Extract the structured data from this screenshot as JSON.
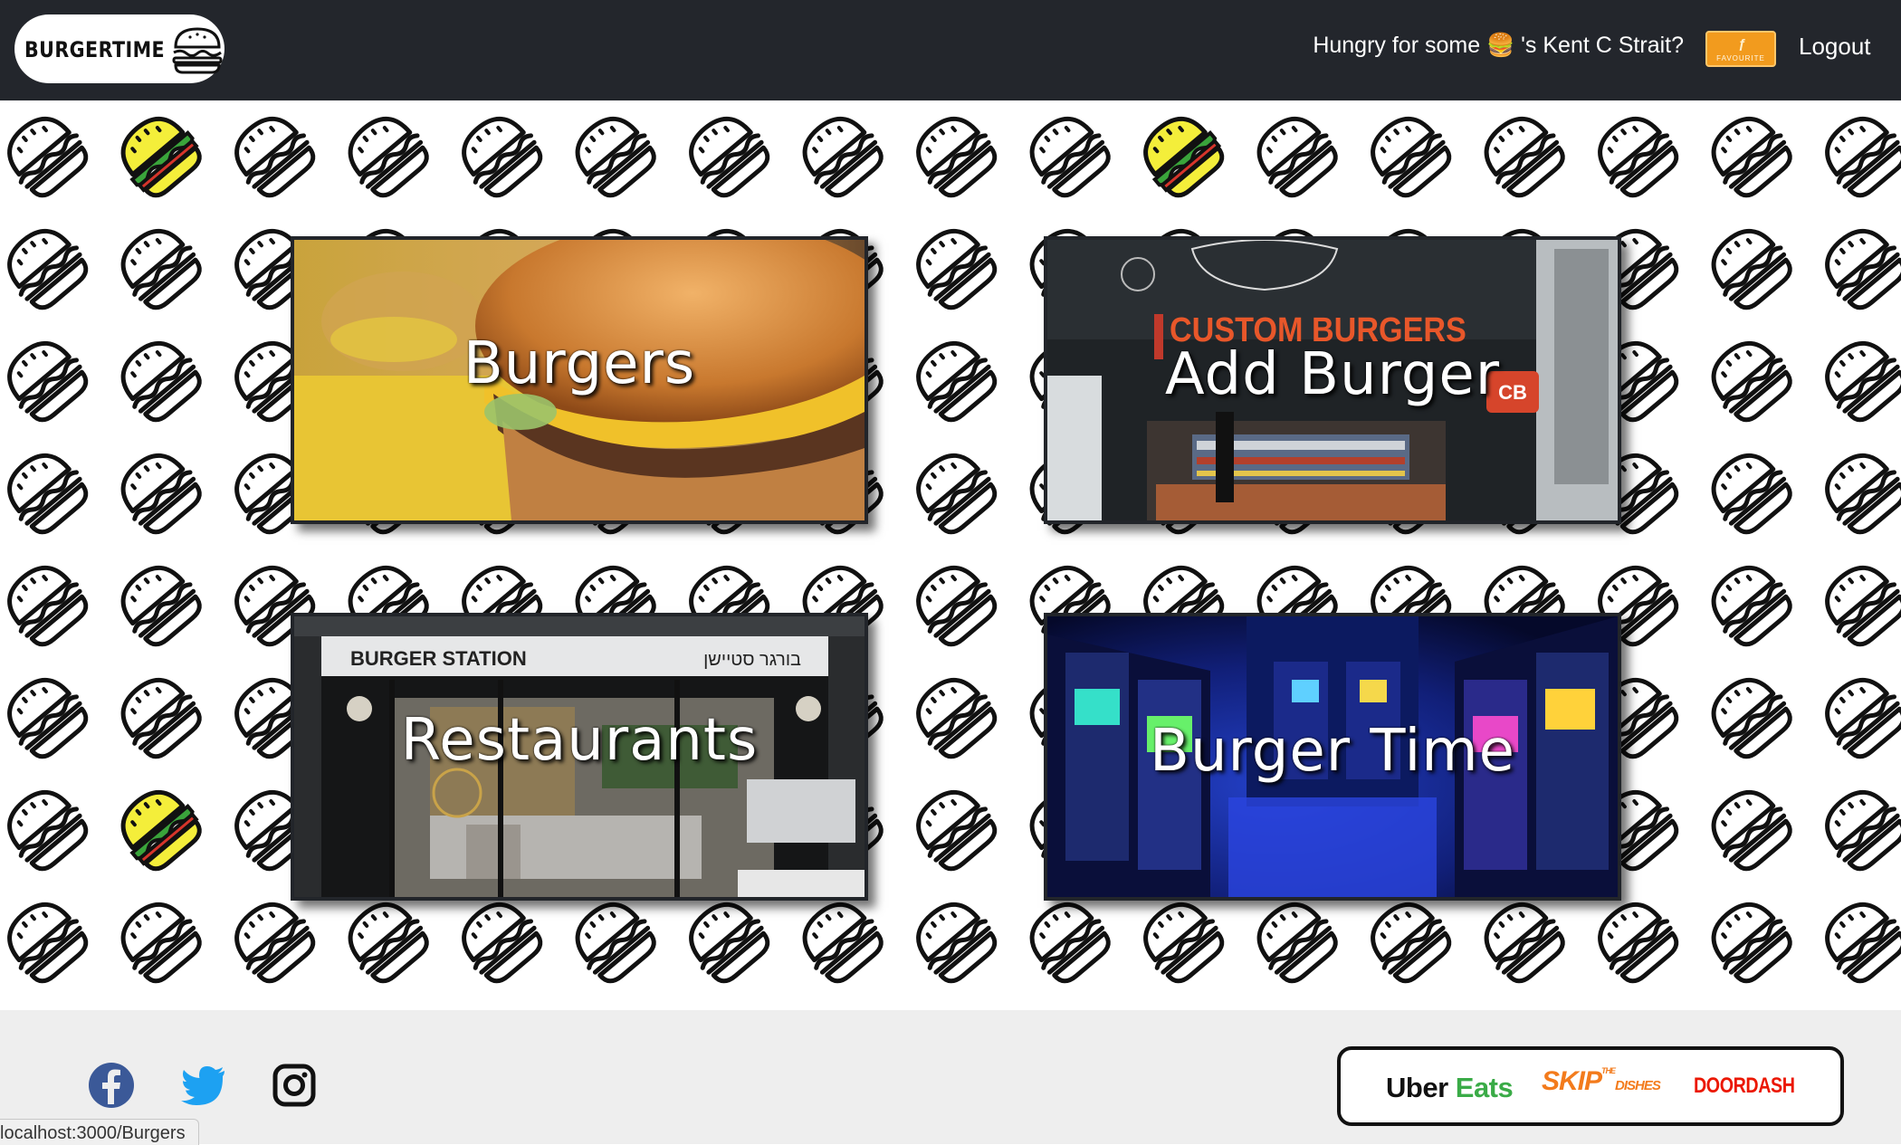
{
  "navbar": {
    "logo_text": "BURGERTIME",
    "greeting_before": "Hungry for some ",
    "greeting_emoji": "🍔",
    "greeting_after": " 's Kent C Strait?",
    "favourite_label": "FAVOURITE",
    "logout_label": "Logout",
    "background_color": "#23262c"
  },
  "cards": [
    {
      "title": "Burgers"
    },
    {
      "title": "Add Burger",
      "sign_text": "CUSTOM BURGERS",
      "logo_text": "CB"
    },
    {
      "title": "Restaurants",
      "sign_text": "BURGER STATION",
      "sign_text_hebrew": "בורגר סטיישן"
    },
    {
      "title": "Burger Time"
    }
  ],
  "footer": {
    "social": [
      "facebook-icon",
      "twitter-icon",
      "instagram-icon"
    ],
    "delivery": {
      "uber_label": "Uber",
      "eats_label": "Eats",
      "skip_label": "SKIP",
      "skip_the": "THE",
      "skip_dishes": "DISHES",
      "doordash_label": "DOORDASH"
    }
  },
  "status_bar": {
    "url": "localhost:3000/Burgers"
  },
  "colors": {
    "accent": "#f29b1e",
    "uber_green": "#3aab47",
    "skip_orange": "#f37b1c",
    "doordash_red": "#eb1700",
    "pattern_highlight": "#f4ee3a"
  }
}
